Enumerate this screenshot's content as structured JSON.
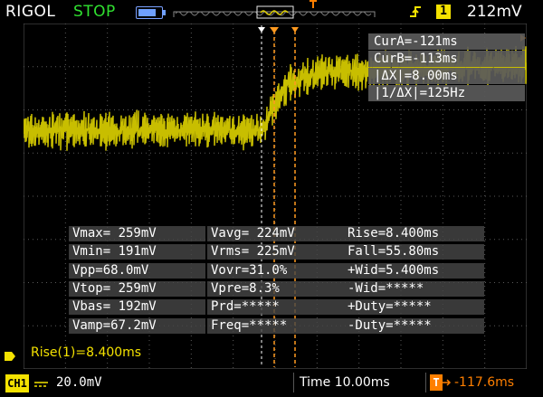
{
  "header": {
    "brand": "RIGOL",
    "run_state": "STOP",
    "trigger_source": "1",
    "trigger_level": "212mV"
  },
  "cursors": {
    "cur_a": "CurA=-121ms",
    "cur_b": "CurB=-113ms",
    "delta_x": "|ΔX|=8.00ms",
    "inv_delta_x": "|1/ΔX|=125Hz"
  },
  "measurements": [
    [
      "Vmax= 259mV",
      "Vavg= 224mV",
      "Rise=8.400ms"
    ],
    [
      "Vmin= 191mV",
      "Vrms= 225mV",
      "Fall=55.80ms"
    ],
    [
      "Vpp=68.0mV",
      "Vovr=31.0%",
      "+Wid=5.400ms"
    ],
    [
      "Vtop= 259mV",
      "Vpre=8.3%",
      "-Wid=*****"
    ],
    [
      "Vbas= 192mV",
      "Prd=*****",
      "+Duty=*****"
    ],
    [
      "Vamp=67.2mV",
      "Freq=*****",
      "-Duty=*****"
    ]
  ],
  "rise_readout": "Rise(1)=8.400ms",
  "footer": {
    "channel": "CH1",
    "channel_scale": "20.0mV",
    "timebase": "Time 10.00ms",
    "trigger_position": "-117.6ms"
  },
  "colors": {
    "trace": "#c8be00",
    "cursor": "#ff9a20",
    "grid": "#5a5a5a",
    "ch1": "#f4e200"
  },
  "waveform": {
    "channel": "CH1",
    "volts_per_div": 20.0,
    "time_per_div_ms": 10.0,
    "low_level_mV": 192,
    "high_level_mV": 259,
    "rise_time_ms": 8.4
  }
}
